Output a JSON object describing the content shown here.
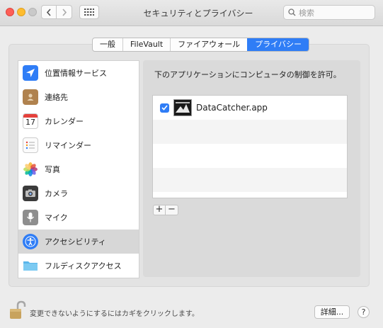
{
  "window": {
    "title": "セキュリティとプライバシー",
    "search_placeholder": "検索"
  },
  "tabs": [
    {
      "label": "一般",
      "active": false
    },
    {
      "label": "FileVault",
      "active": false
    },
    {
      "label": "ファイアウォール",
      "active": false
    },
    {
      "label": "プライバシー",
      "active": true
    }
  ],
  "sidebar": {
    "items": [
      {
        "label": "位置情報サービス",
        "icon": "location-arrow-icon"
      },
      {
        "label": "連絡先",
        "icon": "contacts-book-icon"
      },
      {
        "label": "カレンダー",
        "icon": "calendar-icon",
        "calendar_day": "17"
      },
      {
        "label": "リマインダー",
        "icon": "reminders-icon"
      },
      {
        "label": "写真",
        "icon": "photos-flower-icon"
      },
      {
        "label": "カメラ",
        "icon": "camera-icon"
      },
      {
        "label": "マイク",
        "icon": "microphone-icon"
      },
      {
        "label": "アクセシビリティ",
        "icon": "accessibility-icon",
        "selected": true
      },
      {
        "label": "フルディスクアクセス",
        "icon": "folder-icon"
      }
    ]
  },
  "content": {
    "description": "下のアプリケーションにコンピュータの制御を許可。",
    "apps": [
      {
        "name": "DataCatcher.app",
        "checked": true,
        "icon": "datacatcher-app-icon"
      }
    ],
    "plus_label": "+",
    "minus_label": "−"
  },
  "footer": {
    "lock_text": "変更できないようにするにはカギをクリックします。",
    "details_label": "詳細...",
    "help_label": "?"
  },
  "colors": {
    "accent": "#2f7df6",
    "close": "#fd5f57",
    "minimize": "#febc2e"
  }
}
